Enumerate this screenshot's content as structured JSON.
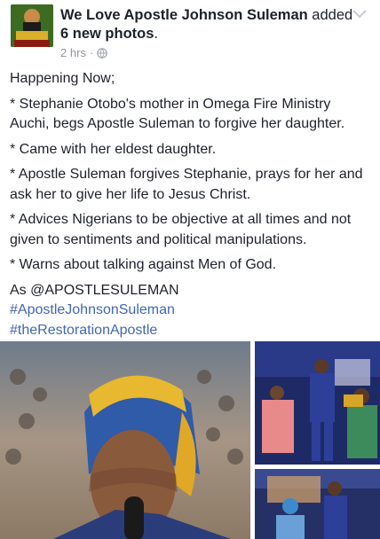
{
  "post": {
    "page_name": "We Love Apostle Johnson Suleman",
    "action_text": " added",
    "action_bold": "6 new photos",
    "action_end": ".",
    "time": "2 hrs",
    "separator": "·",
    "body": {
      "p1": "Happening Now;",
      "p2": "* Stephanie Otobo's mother in Omega Fire Ministry Auchi, begs Apostle Suleman to forgive her daughter.",
      "p3": "* Came with her eldest daughter.",
      "p4": "* Apostle Suleman forgives Stephanie, prays for her and ask her to give her life to Jesus Christ.",
      "p5": "* Advices Nigerians to be objective at all times and not given to sentiments and political manipulations.",
      "p6": "* Warns about talking against Men of God.",
      "p7": "As @APOSTLESULEMAN",
      "hashtag1": "#ApostleJohnsonSuleman",
      "hashtag2": "#theRestorationApostle"
    },
    "icons": {
      "avatar": "page-avatar",
      "privacy": "globe-icon",
      "menu": "chevron-down-icon"
    }
  }
}
